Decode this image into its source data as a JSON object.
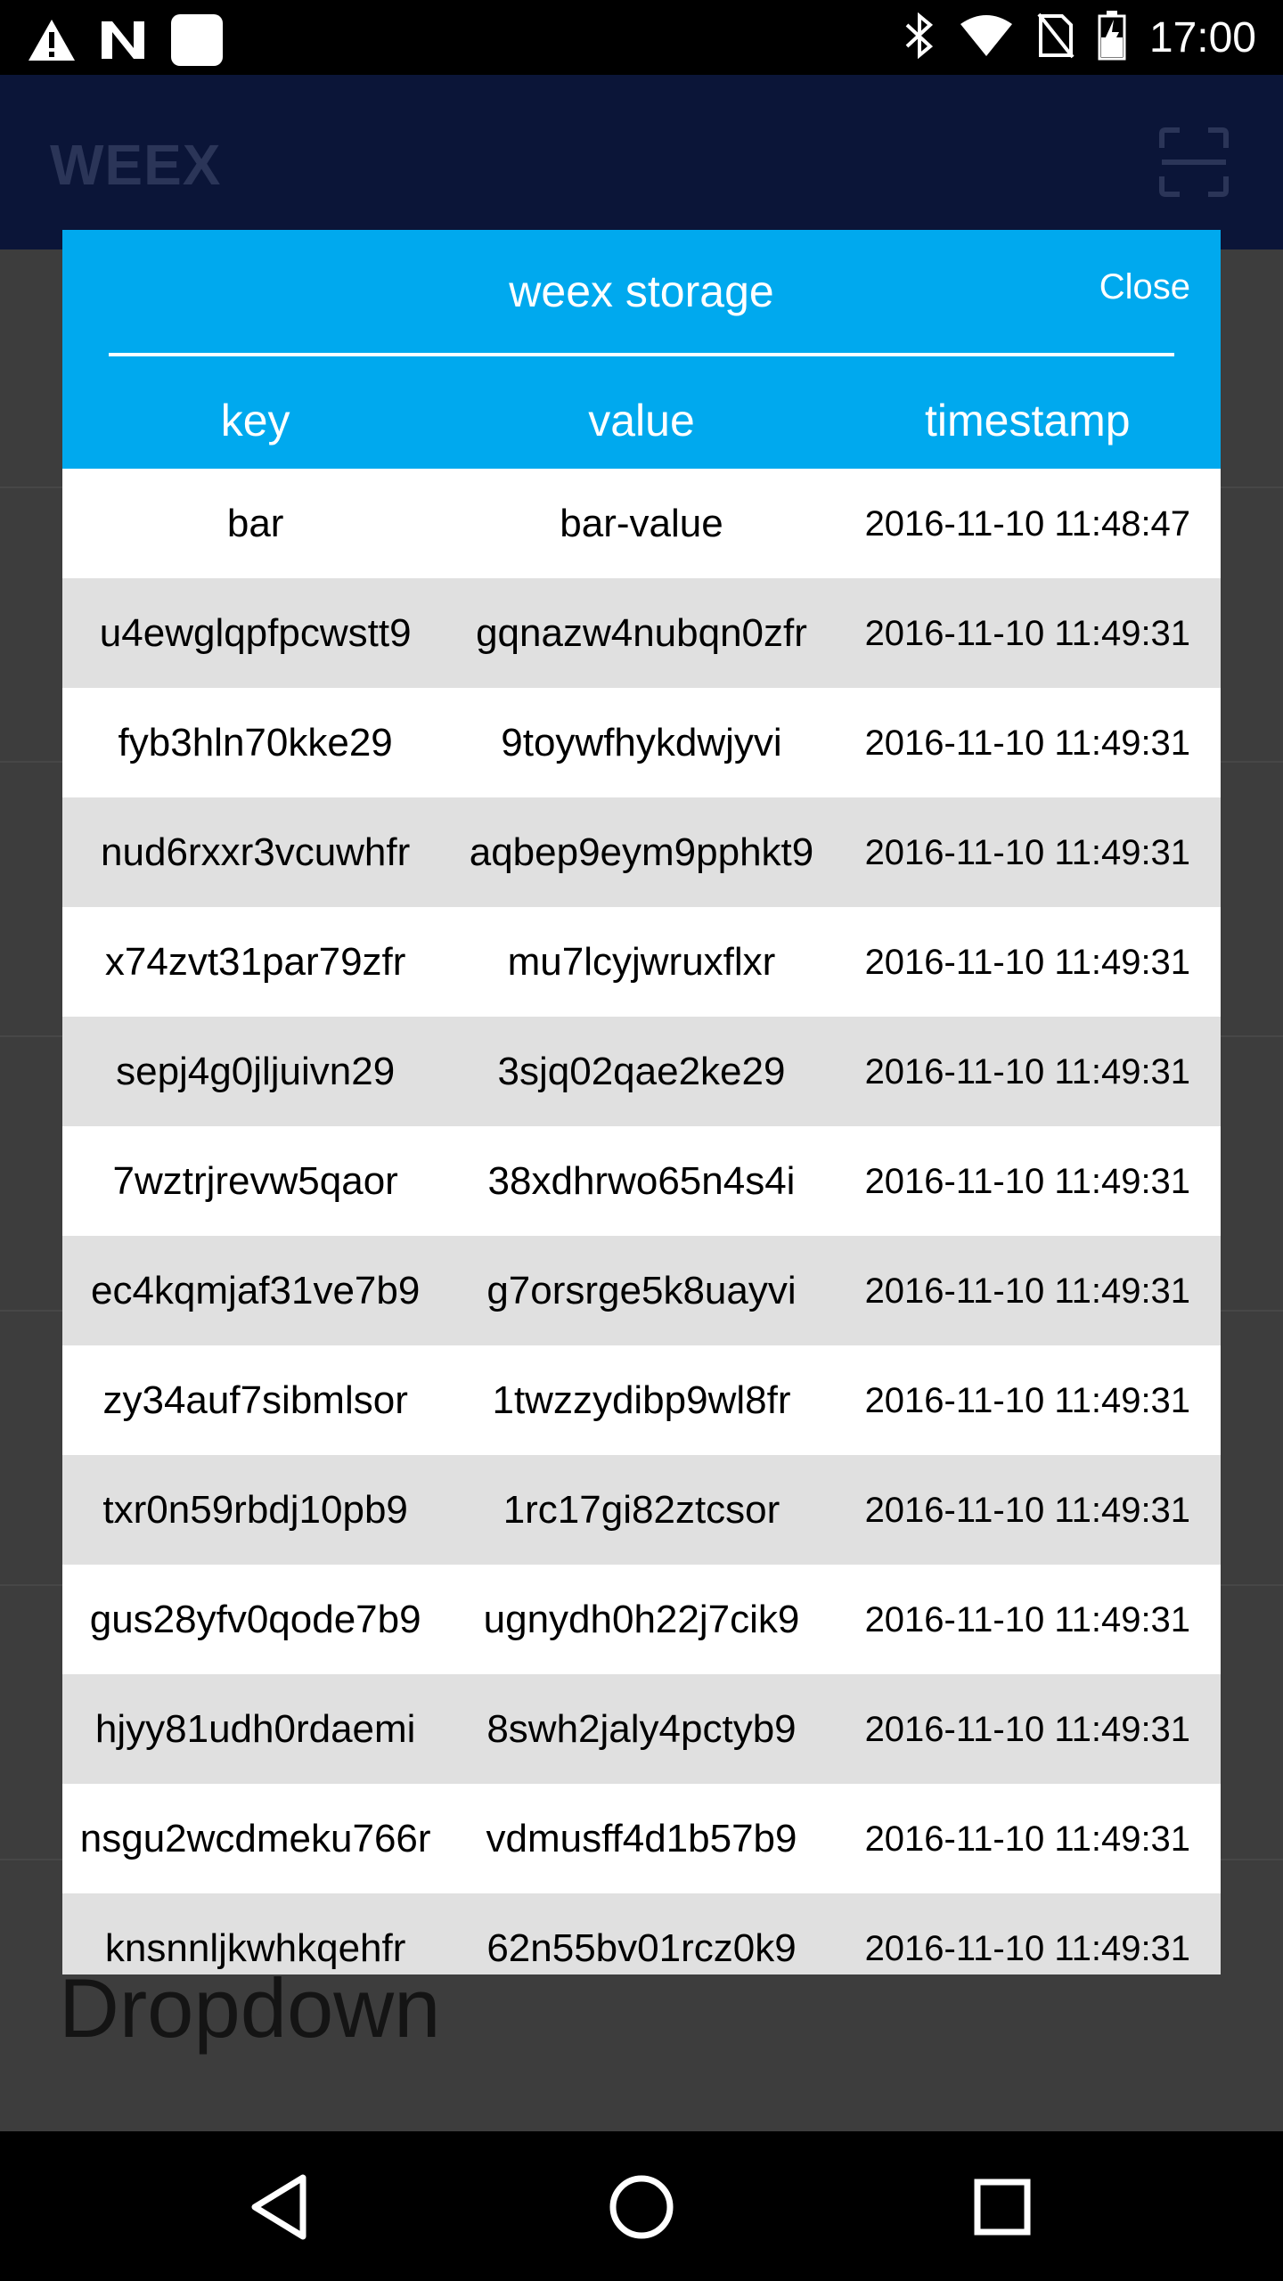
{
  "status_bar": {
    "time": "17:00",
    "left_icons": [
      "warning-icon",
      "n-icon",
      "square-icon"
    ],
    "right_icons": [
      "bluetooth-icon",
      "wifi-icon",
      "no-sim-icon",
      "battery-charging-icon"
    ]
  },
  "app_bar": {
    "title": "WEEX",
    "action_icon": "scan-icon"
  },
  "background": {
    "label": "Dropdown"
  },
  "dialog": {
    "title": "weex storage",
    "close_label": "Close",
    "columns": [
      "key",
      "value",
      "timestamp"
    ],
    "rows": [
      {
        "key": "bar",
        "value": "bar-value",
        "timestamp": "2016-11-10 11:48:47"
      },
      {
        "key": "u4ewglqpfpcwstt9",
        "value": "gqnazw4nubqn0zfr",
        "timestamp": "2016-11-10 11:49:31"
      },
      {
        "key": "fyb3hln70kke29",
        "value": "9toywfhykdwjyvi",
        "timestamp": "2016-11-10 11:49:31"
      },
      {
        "key": "nud6rxxr3vcuwhfr",
        "value": "aqbep9eym9pphkt9",
        "timestamp": "2016-11-10 11:49:31"
      },
      {
        "key": "x74zvt31par79zfr",
        "value": "mu7lcyjwruxflxr",
        "timestamp": "2016-11-10 11:49:31"
      },
      {
        "key": "sepj4g0jljuivn29",
        "value": "3sjq02qae2ke29",
        "timestamp": "2016-11-10 11:49:31"
      },
      {
        "key": "7wztrjrevw5qaor",
        "value": "38xdhrwo65n4s4i",
        "timestamp": "2016-11-10 11:49:31"
      },
      {
        "key": "ec4kqmjaf31ve7b9",
        "value": "g7orsrge5k8uayvi",
        "timestamp": "2016-11-10 11:49:31"
      },
      {
        "key": "zy34auf7sibmlsor",
        "value": "1twzzydibp9wl8fr",
        "timestamp": "2016-11-10 11:49:31"
      },
      {
        "key": "txr0n59rbdj10pb9",
        "value": "1rc17gi82ztcsor",
        "timestamp": "2016-11-10 11:49:31"
      },
      {
        "key": "gus28yfv0qode7b9",
        "value": "ugnydh0h22j7cik9",
        "timestamp": "2016-11-10 11:49:31"
      },
      {
        "key": "hjyy81udh0rdaemi",
        "value": "8swh2jaly4pctyb9",
        "timestamp": "2016-11-10 11:49:31"
      },
      {
        "key": "nsgu2wcdmeku766r",
        "value": "vdmusff4d1b57b9",
        "timestamp": "2016-11-10 11:49:31"
      },
      {
        "key": "knsnnljkwhkqehfr",
        "value": "62n55bv01rcz0k9",
        "timestamp": "2016-11-10 11:49:31"
      }
    ]
  },
  "nav_bar": {
    "back_icon": "back-triangle-icon",
    "home_icon": "home-circle-icon",
    "recents_icon": "recents-square-icon"
  },
  "colors": {
    "dialog_header": "#00a9ee",
    "row_alt": "#e0e0e0",
    "app_bar": "#0b1538"
  }
}
